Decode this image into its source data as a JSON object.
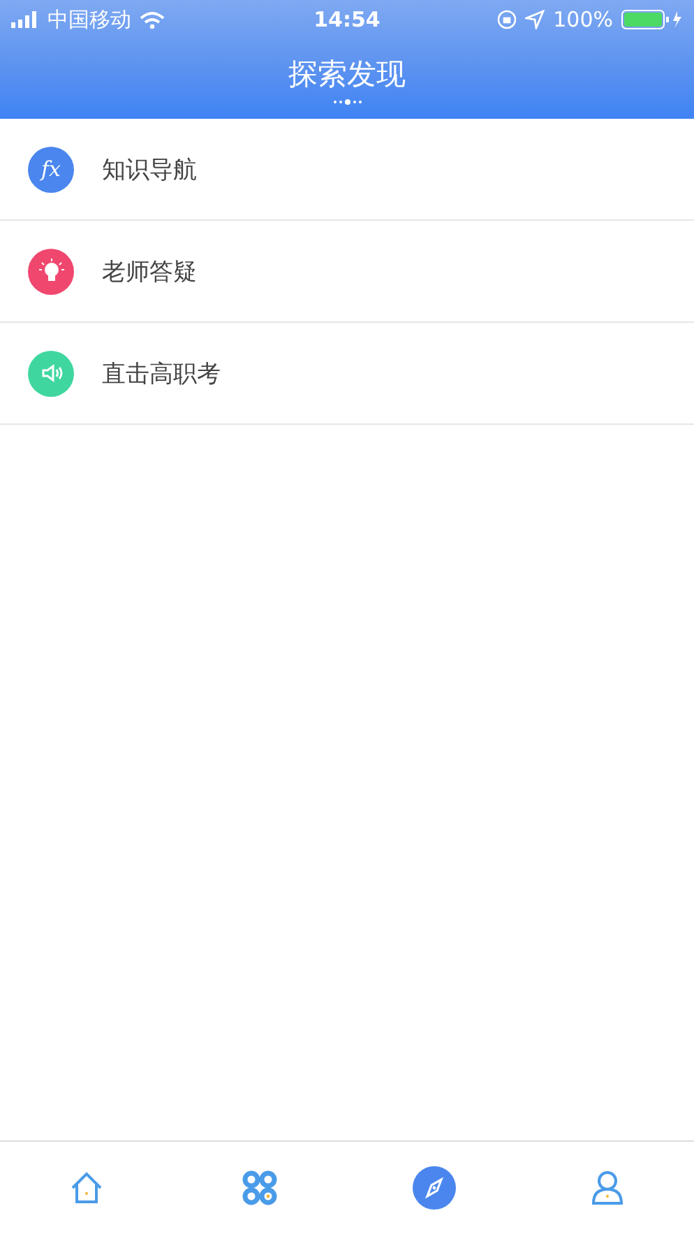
{
  "status_bar": {
    "carrier": "中国移动",
    "time": "14:54",
    "battery_text": "100%",
    "battery": {
      "level": 1,
      "charging": true
    }
  },
  "header": {
    "title": "探索发现",
    "page_dots": [
      {
        "selected": false
      },
      {
        "selected": false
      },
      {
        "selected": true
      },
      {
        "selected": false
      },
      {
        "selected": false
      }
    ]
  },
  "menu": [
    {
      "kind": "formula",
      "glyph": "fx",
      "label": "知识导航",
      "color": "#4a86ee"
    },
    {
      "kind": "bulb",
      "label": "老师答疑",
      "color": "#f0476f"
    },
    {
      "kind": "speaker",
      "label": "直击高职考",
      "color": "#3fd79f"
    }
  ],
  "tab_bar": [
    {
      "kind": "home",
      "selected": false
    },
    {
      "kind": "apps",
      "selected": false
    },
    {
      "kind": "discover",
      "selected": true
    },
    {
      "kind": "profile",
      "selected": false
    }
  ]
}
